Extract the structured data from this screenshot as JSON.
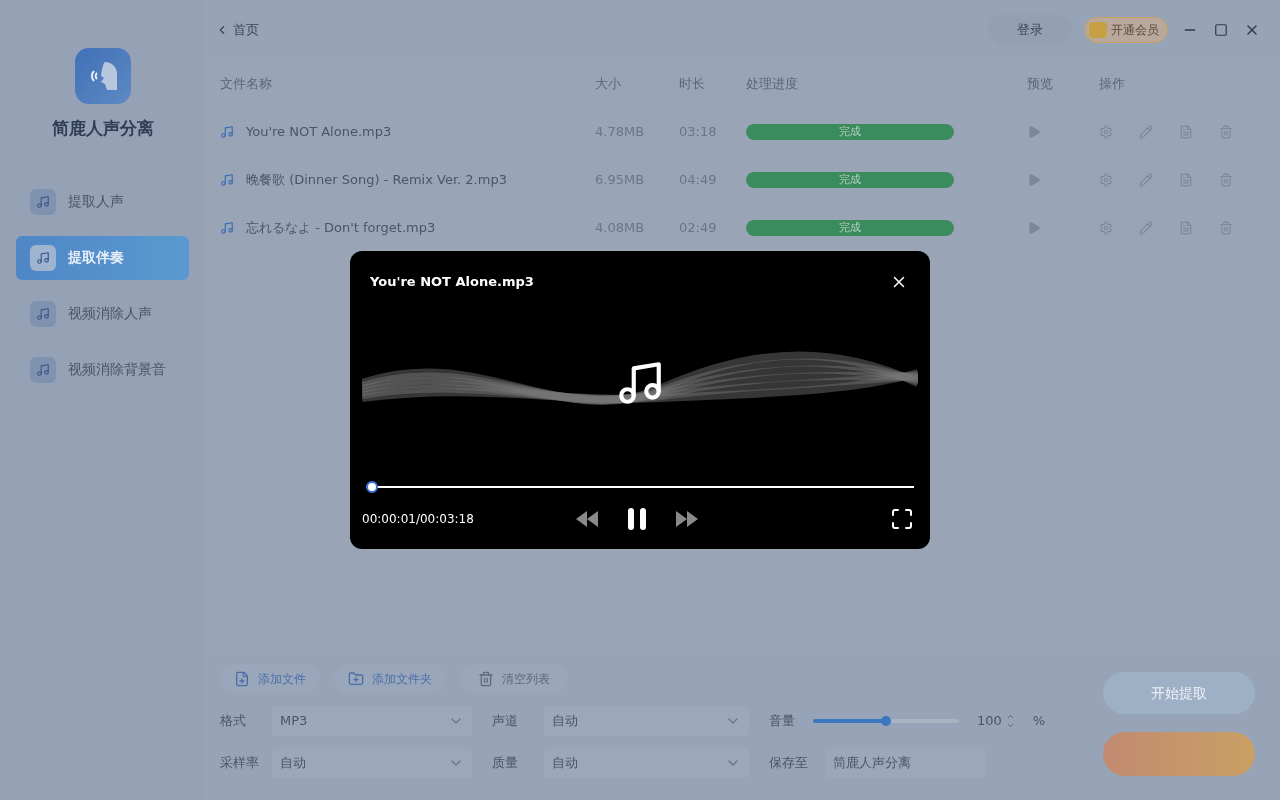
{
  "app": {
    "name": "简鹿人声分离"
  },
  "nav": [
    {
      "label": "提取人声",
      "selected": false
    },
    {
      "label": "提取伴奏",
      "selected": true
    },
    {
      "label": "视频消除人声",
      "selected": false
    },
    {
      "label": "视频消除背景音",
      "selected": false
    }
  ],
  "header": {
    "breadcrumb": "首页",
    "login": "登录",
    "vip": "开通会员"
  },
  "table": {
    "columns": [
      "文件名称",
      "大小",
      "时长",
      "处理进度",
      "预览",
      "操作"
    ],
    "rows": [
      {
        "name": "You're NOT Alone.mp3",
        "size": "4.78MB",
        "duration": "03:18",
        "status": "完成",
        "level": 1
      },
      {
        "name": "晚餐歌 (Dinner Song) - Remix Ver. 2.mp3",
        "size": "6.95MB",
        "duration": "04:49",
        "status": "完成",
        "level": 1
      },
      {
        "name": "忘れるなよ - Don't forget.mp3",
        "size": "4.08MB",
        "duration": "02:49",
        "status": "完成",
        "level": 1
      }
    ]
  },
  "toolbar": {
    "add_file": "添加文件",
    "add_folder": "添加文件夹",
    "clear": "清空列表",
    "start": "开始提取"
  },
  "settings": {
    "format_label": "格式",
    "format": "MP3",
    "channel_label": "声道",
    "channel": "自动",
    "volume_label": "音量",
    "volume": {
      "level": 0.5
    },
    "volume_value": "100",
    "volume_unit": "%",
    "rate_label": "采样率",
    "rate": "自动",
    "quality_label": "质量",
    "quality": "自动",
    "save_label": "保存至",
    "save": "简鹿人声分离"
  },
  "player": {
    "title": "You're NOT Alone.mp3",
    "progress": {
      "level": 0
    },
    "time": "00:00:01/00:03:18"
  }
}
